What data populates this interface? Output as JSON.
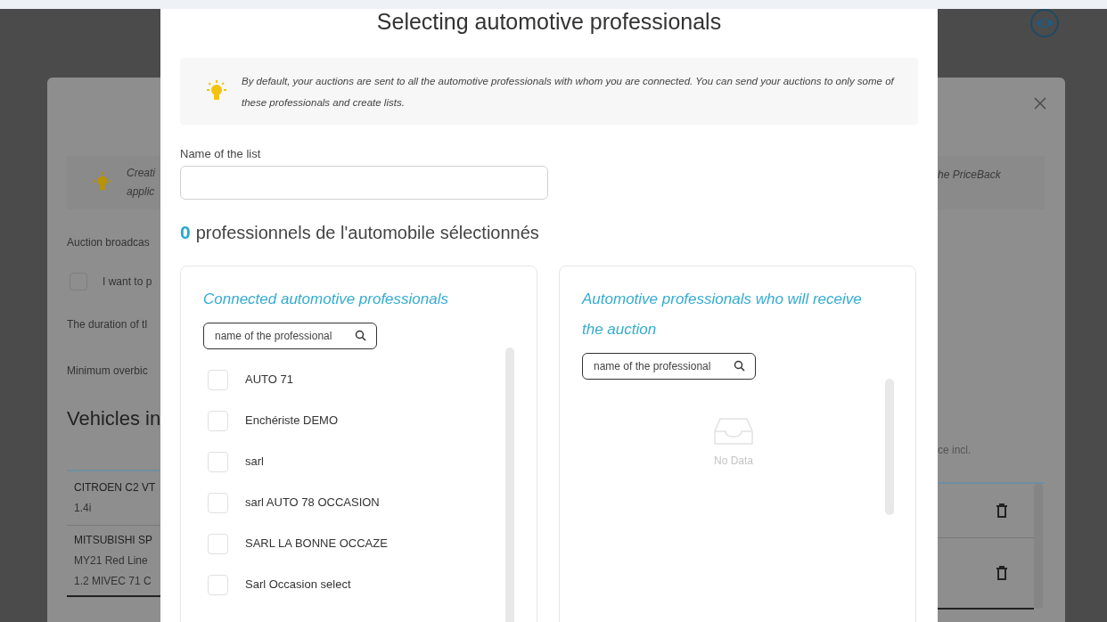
{
  "background_window": {
    "hint_left": [
      "Creati",
      "applic"
    ],
    "hint_right": "he PriceBack",
    "broadcast_label": "Auction broadcas",
    "checkbox": {
      "label": "I want to p",
      "checked": false
    },
    "duration_label": "The duration of tl",
    "overbid_label": "Minimum overbic",
    "section_title": "Vehicles in",
    "column_fragment": "ce incl.",
    "vehicles": [
      {
        "lines": [
          "CITROEN C2 VT",
          "1.4i"
        ]
      },
      {
        "lines": [
          "MITSUBISHI SP",
          "MY21 Red Line",
          "1.2 MIVEC 71 C"
        ]
      }
    ]
  },
  "dialog": {
    "title": "Selecting automotive professionals",
    "info": "By default, your auctions are sent to all the automotive professionals with whom you are connected. You can send your auctions to only some of these professionals and create lists.",
    "name_field": {
      "label": "Name of the list"
    },
    "selected_count": "0",
    "selected_label": "professionnels de l'automobile sélectionnés",
    "panels": [
      {
        "title": "Connected automotive professionals",
        "search": {
          "placeholder": "name of the professional"
        },
        "items": [
          {
            "label": "AUTO 71",
            "checked": false
          },
          {
            "label": "Enchériste DEMO",
            "checked": false
          },
          {
            "label": "sarl",
            "checked": false
          },
          {
            "label": "sarl AUTO 78 OCCASION",
            "checked": false
          },
          {
            "label": "SARL LA BONNE OCCAZE",
            "checked": false
          },
          {
            "label": "Sarl Occasion select",
            "checked": false
          }
        ]
      },
      {
        "title": "Automotive professionals who will receive the auction",
        "search": {
          "placeholder": "name of the professional"
        },
        "empty_text": "No Data"
      }
    ]
  }
}
